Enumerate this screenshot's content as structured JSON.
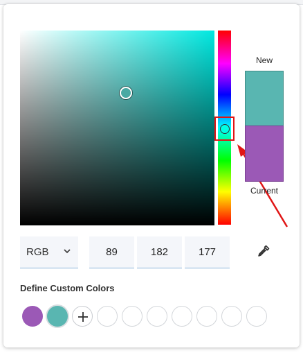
{
  "preview": {
    "new_label": "New",
    "current_label": "Current",
    "new_color": "#59b6b1",
    "current_color": "#9b59b6"
  },
  "picker": {
    "hue_color": "#00e8e0",
    "annotation_color": "#e01515"
  },
  "inputs": {
    "mode": "RGB",
    "r": "89",
    "g": "182",
    "b": "177"
  },
  "custom_colors": {
    "heading": "Define Custom Colors",
    "swatches": [
      "#9b59b6",
      "#59b6b1"
    ],
    "empty_slot_count": 7
  },
  "icons": {
    "mode_dropdown": "chevron-down-icon",
    "eyedropper": "eyedropper-icon",
    "add": "plus-icon"
  }
}
